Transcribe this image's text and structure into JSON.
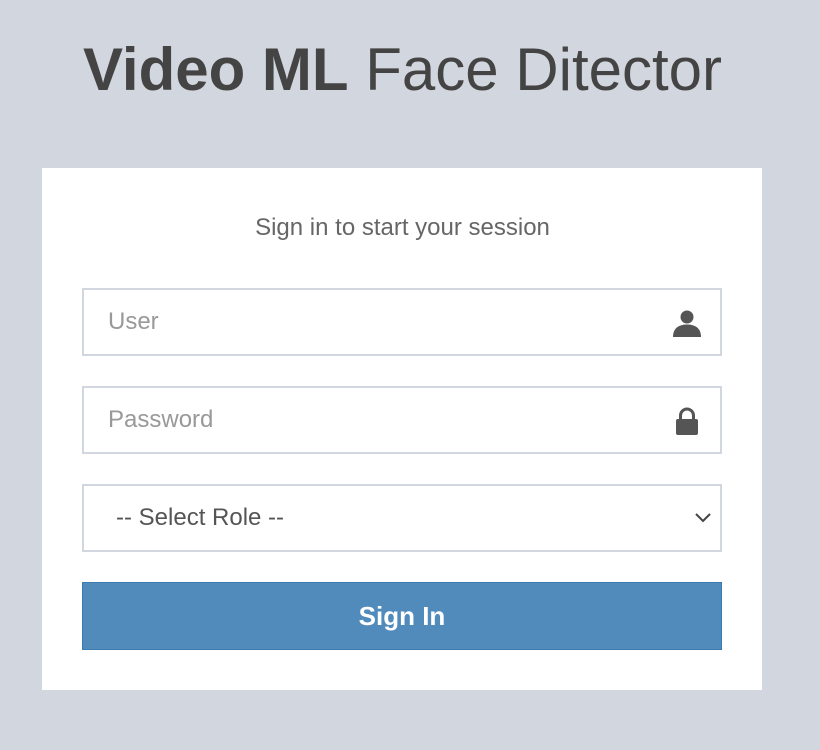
{
  "logo": {
    "bold": "Video ML",
    "light": "Face Ditector"
  },
  "login": {
    "message": "Sign in to start your session",
    "user": {
      "placeholder": "User",
      "value": "",
      "icon": "user-icon"
    },
    "password": {
      "placeholder": "Password",
      "value": "",
      "icon": "lock-icon"
    },
    "role": {
      "selected": "-- Select Role --",
      "icon": "chevron-down-icon"
    },
    "submit_label": "Sign In"
  },
  "colors": {
    "background": "#d2d6de",
    "primary": "#518bbb",
    "text": "#444444"
  }
}
